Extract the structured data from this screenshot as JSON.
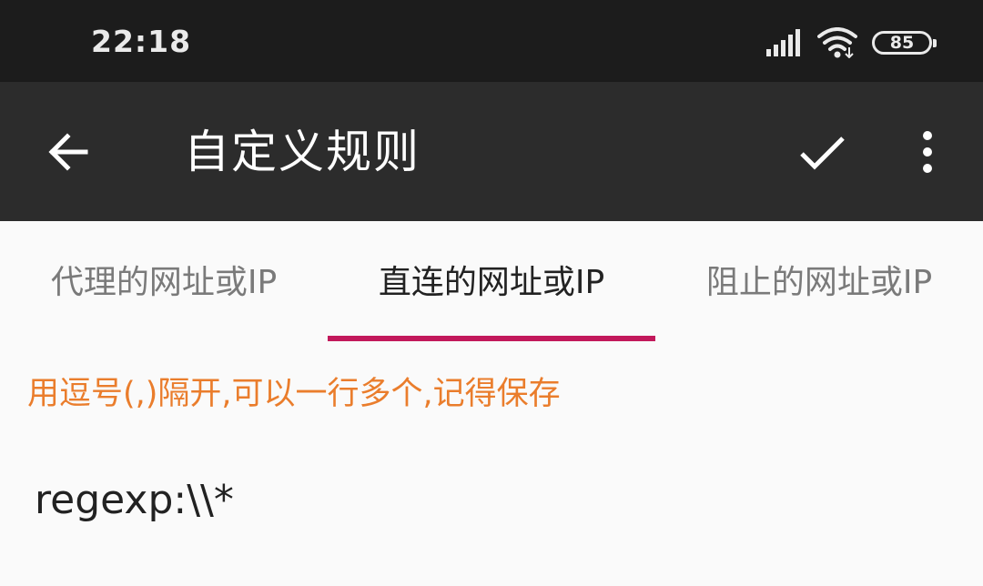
{
  "status_bar": {
    "time": "22:18",
    "battery_level": "85",
    "icons": [
      "signal-icon",
      "wifi-icon",
      "battery-icon"
    ]
  },
  "app_bar": {
    "title": "自定义规则",
    "icons": [
      "back-arrow-icon",
      "checkmark-icon",
      "overflow-menu-icon"
    ]
  },
  "tabs": [
    {
      "label": "代理的网址或IP",
      "active": false
    },
    {
      "label": "直连的网址或IP",
      "active": true
    },
    {
      "label": "阻止的网址或IP",
      "active": false
    }
  ],
  "hint": "用逗号(,)隔开,可以一行多个,记得保存",
  "rules_input": {
    "value": "regexp:\\\\*"
  },
  "colors": {
    "status_bar_bg": "#1c1c1c",
    "app_bar_bg": "#2c2c2c",
    "tab_indicator": "#c2185b",
    "hint_text": "#ea7d2c",
    "background": "#fafafa"
  }
}
